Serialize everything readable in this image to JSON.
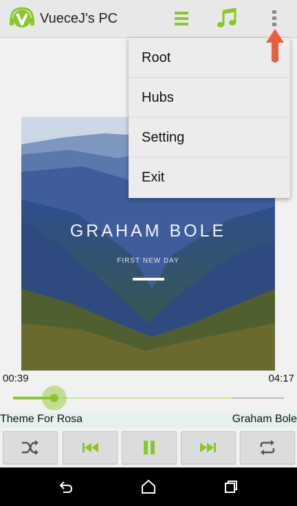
{
  "app": {
    "title": "VueceJ's PC",
    "logo_icon": "vuece-headphones-logo",
    "accent": "#8cc62a"
  },
  "actionbar": {
    "playlist_icon": "list-icon",
    "music_icon": "music-note-icon",
    "overflow_icon": "overflow-menu-icon"
  },
  "now_playing": {
    "title": "Grah",
    "album": "Firs",
    "track": "Them"
  },
  "album_art": {
    "artist_text": "GRAHAM BOLE",
    "subtitle_text": "FIRST NEW DAY"
  },
  "progress": {
    "elapsed": "00:39",
    "duration": "04:17",
    "position_fraction": 0.152,
    "buffer_fraction": 0.81
  },
  "track_strip": {
    "title": "Theme For Rosa",
    "artist": "Graham Bole"
  },
  "controls": [
    "shuffle-icon",
    "previous-icon",
    "pause-icon",
    "next-icon",
    "repeat-icon"
  ],
  "menu": {
    "items": [
      "Root",
      "Hubs",
      "Setting",
      "Exit"
    ]
  },
  "navbar": [
    "back-icon",
    "home-icon",
    "recents-icon"
  ]
}
